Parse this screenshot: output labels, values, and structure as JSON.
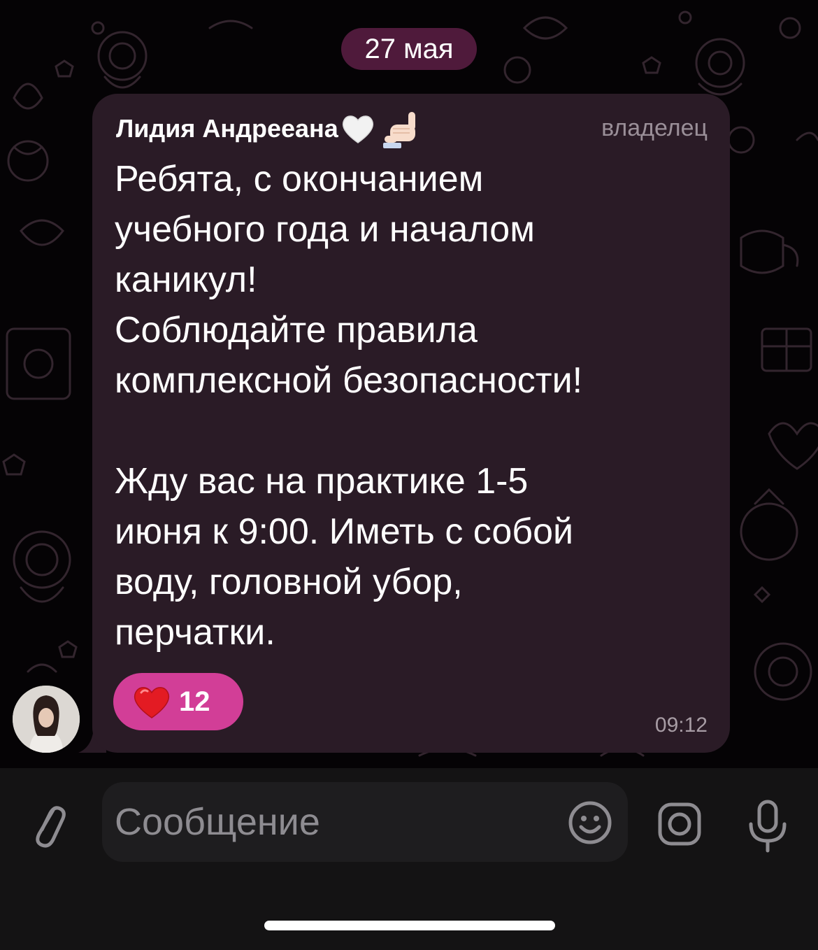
{
  "chat": {
    "date_separator": "27 мая",
    "message": {
      "sender_name": "Лидия Андреeана",
      "sender_emoji": [
        "white-heart",
        "call-me-hand"
      ],
      "role": "владелец",
      "text": "Ребята, с окончанием\nучебного года и началом\nканикул!\nСоблюдайте правила\nкомплексной безопасности!\n\nЖду вас на практике 1-5\nиюня к 9:00. Иметь с собой\nводу, головной убор,\nперчатки.",
      "reaction": {
        "emoji": "red-heart",
        "count": "12"
      },
      "time": "09:12"
    }
  },
  "composer": {
    "placeholder": "Сообщение",
    "icons": [
      "paperclip-icon",
      "emoji-icon",
      "camera-icon",
      "microphone-icon"
    ]
  },
  "colors": {
    "bubble": "#2a1b26",
    "date_pill": "#561c40",
    "reaction": "#d23e97",
    "input_bar": "#141314",
    "doodle_stroke": "#3a2a33"
  }
}
